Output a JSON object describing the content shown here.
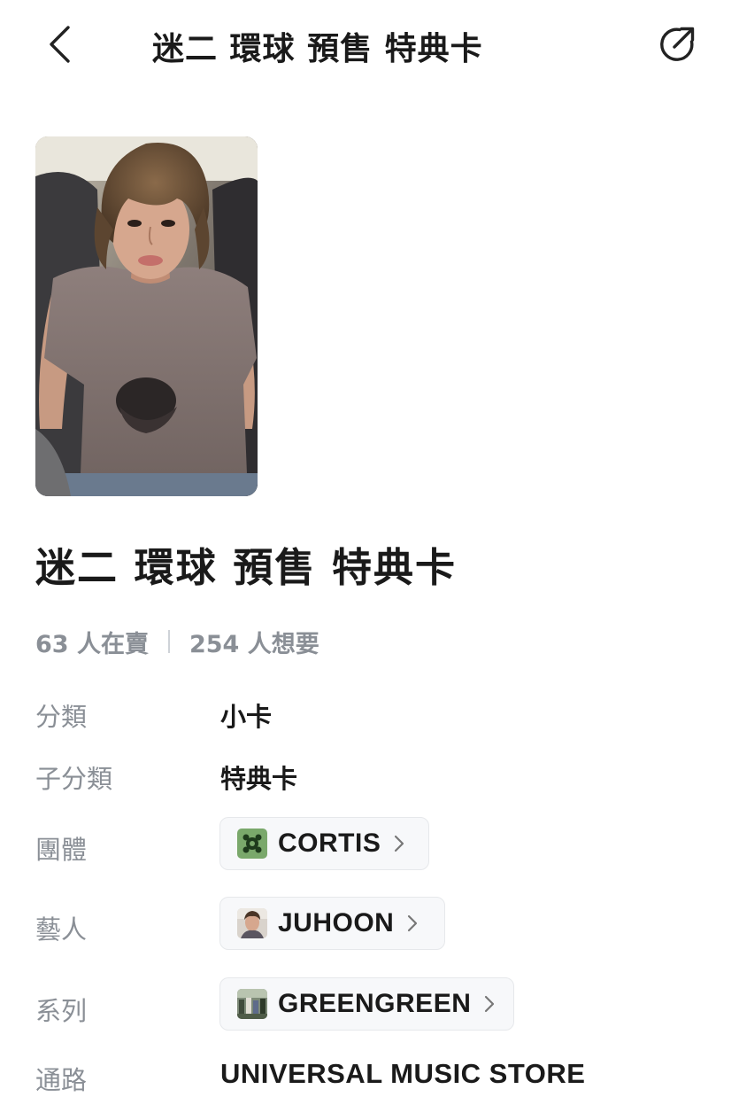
{
  "header": {
    "title": "迷二 環球 預售 特典卡",
    "back_icon": "chevron-left-icon",
    "share_icon": "share-icon"
  },
  "product": {
    "image_description": "photocard",
    "title": "迷二 環球 預售 特典卡",
    "selling_count": "63 人在賣",
    "wanting_count": "254 人想要"
  },
  "details": {
    "category": {
      "label": "分類",
      "value": "小卡"
    },
    "subcategory": {
      "label": "子分類",
      "value": "特典卡"
    },
    "group": {
      "label": "團體",
      "value": "CORTIS"
    },
    "artist": {
      "label": "藝人",
      "value": "JUHOON"
    },
    "series": {
      "label": "系列",
      "value": "GREENGREEN"
    },
    "channel": {
      "label": "通路",
      "value": "UNIVERSAL MUSIC STORE"
    }
  },
  "colors": {
    "text_primary": "#1a1a1a",
    "text_secondary": "#8a8f96",
    "chip_bg": "#f7f8fa",
    "chip_border": "#e6e8eb",
    "group_logo_green": "#7aa86b"
  }
}
